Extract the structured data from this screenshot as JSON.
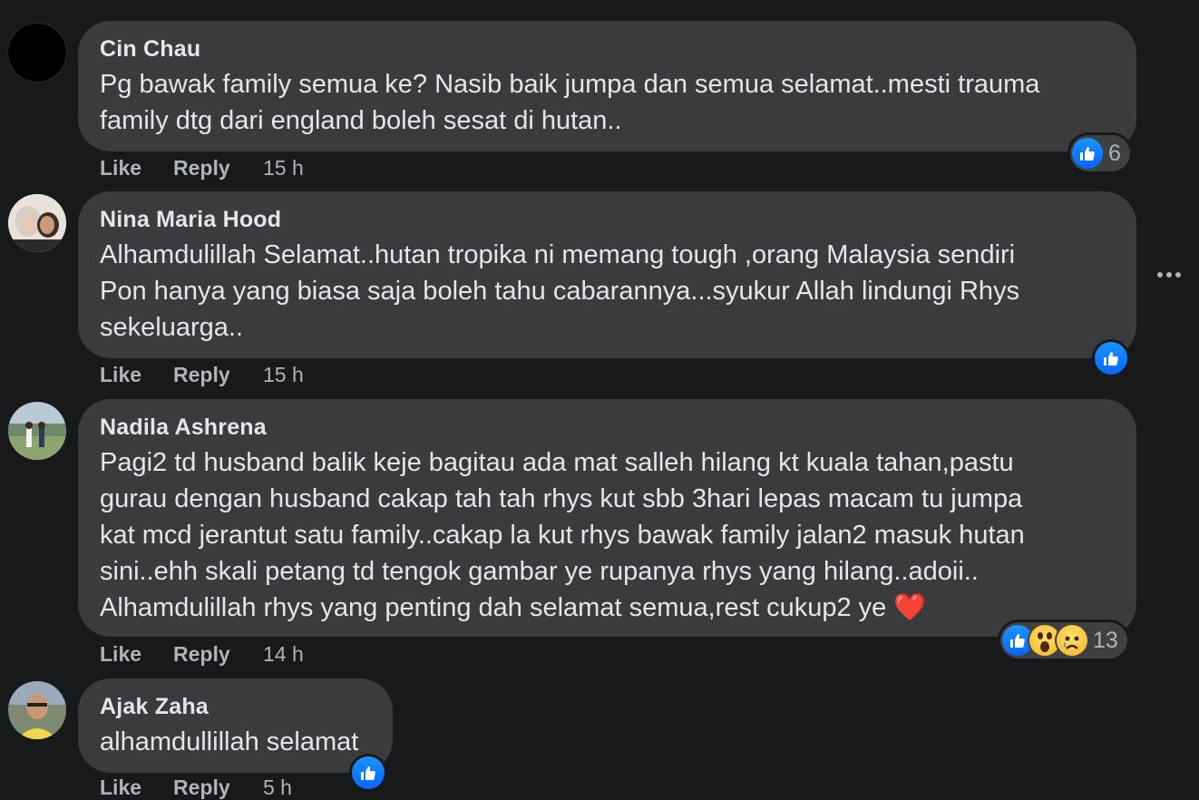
{
  "comments": [
    {
      "author": "Cin Chau",
      "text": "Pg bawak family semua ke? Nasib baik jumpa dan semua selamat..mesti trauma\nfamily dtg dari england boleh sesat di hutan..",
      "like_label": "Like",
      "reply_label": "Reply",
      "time": "15 h",
      "reaction_icons": [
        "like-icon"
      ],
      "reaction_count": "6"
    },
    {
      "author": "Nina Maria Hood",
      "text": "Alhamdulillah Selamat..hutan tropika ni memang tough ,orang Malaysia sendiri\nPon hanya yang biasa saja boleh tahu cabarannya...syukur Allah lindungi Rhys\nsekeluarga..",
      "like_label": "Like",
      "reply_label": "Reply",
      "time": "15 h",
      "reaction_icons": [
        "like-icon"
      ],
      "reaction_count": ""
    },
    {
      "author": "Nadila Ashrena",
      "text": "Pagi2 td husband balik keje bagitau ada mat salleh hilang kt kuala tahan,pastu\ngurau dengan husband cakap tah tah rhys kut sbb 3hari lepas macam tu jumpa\nkat mcd jerantut satu family..cakap la kut rhys bawak family jalan2 masuk hutan\nsini..ehh skali petang td tengok gambar ye rupanya rhys yang hilang..adoii..\nAlhamdulillah rhys yang penting dah selamat semua,rest cukup2 ye ❤️",
      "like_label": "Like",
      "reply_label": "Reply",
      "time": "14 h",
      "reaction_icons": [
        "like-icon",
        "wow-icon",
        "sad-icon"
      ],
      "reaction_count": "13"
    },
    {
      "author": "Ajak Zaha",
      "text": "alhamdullillah selamat",
      "like_label": "Like",
      "reply_label": "Reply",
      "time": "5 h",
      "reaction_icons": [
        "like-icon"
      ],
      "reaction_count": ""
    }
  ],
  "more_options_icon": "more-horizontal-icon",
  "colors": {
    "background": "#18191a",
    "bubble": "#3a3b3c",
    "primary_text": "#e4e6eb",
    "secondary_text": "#b0b3b8",
    "like_blue": "#0866ff"
  }
}
